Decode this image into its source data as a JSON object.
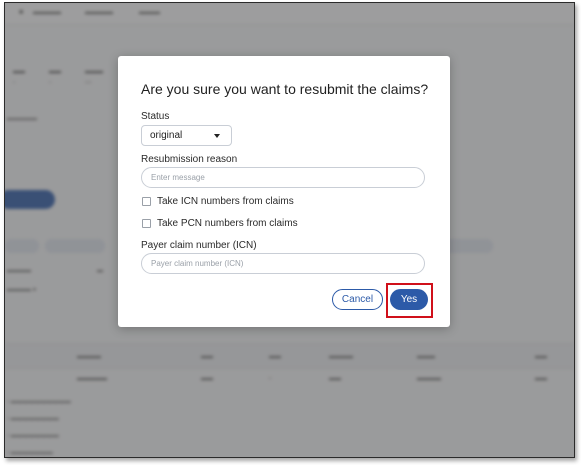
{
  "modal": {
    "title": "Are you sure you want to resubmit the claims?",
    "status_label": "Status",
    "status_value": "original",
    "resubmission_label": "Resubmission reason",
    "resubmission_placeholder": "Enter message",
    "checkbox_icn_label": "Take ICN numbers from claims",
    "checkbox_pcn_label": "Take PCN numbers from claims",
    "payer_claim_label": "Payer claim number (ICN)",
    "payer_claim_placeholder": "Payer claim number (ICN)",
    "cancel_label": "Cancel",
    "yes_label": "Yes"
  },
  "colors": {
    "primary": "#2c5aa8",
    "highlight": "#d0101a"
  }
}
